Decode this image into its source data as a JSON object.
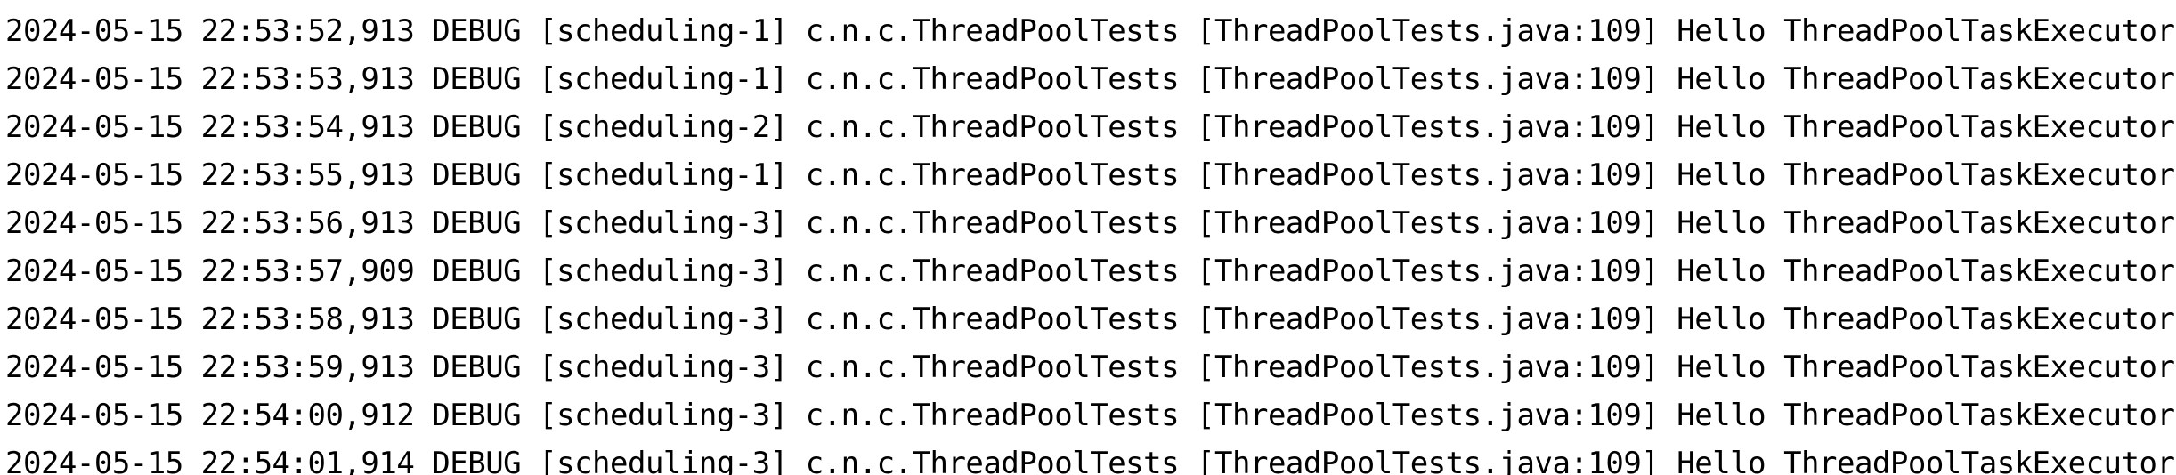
{
  "console": {
    "colors": {
      "background": "#ffffff",
      "text": "#000000"
    },
    "lines": [
      {
        "timestamp": "2024-05-15 22:53:52,913",
        "level": "DEBUG",
        "thread": "[scheduling-1]",
        "logger": "c.n.c.ThreadPoolTests",
        "location": "[ThreadPoolTests.java:109]",
        "message": "Hello ThreadPoolTaskExecutor"
      },
      {
        "timestamp": "2024-05-15 22:53:53,913",
        "level": "DEBUG",
        "thread": "[scheduling-1]",
        "logger": "c.n.c.ThreadPoolTests",
        "location": "[ThreadPoolTests.java:109]",
        "message": "Hello ThreadPoolTaskExecutor"
      },
      {
        "timestamp": "2024-05-15 22:53:54,913",
        "level": "DEBUG",
        "thread": "[scheduling-2]",
        "logger": "c.n.c.ThreadPoolTests",
        "location": "[ThreadPoolTests.java:109]",
        "message": "Hello ThreadPoolTaskExecutor"
      },
      {
        "timestamp": "2024-05-15 22:53:55,913",
        "level": "DEBUG",
        "thread": "[scheduling-1]",
        "logger": "c.n.c.ThreadPoolTests",
        "location": "[ThreadPoolTests.java:109]",
        "message": "Hello ThreadPoolTaskExecutor"
      },
      {
        "timestamp": "2024-05-15 22:53:56,913",
        "level": "DEBUG",
        "thread": "[scheduling-3]",
        "logger": "c.n.c.ThreadPoolTests",
        "location": "[ThreadPoolTests.java:109]",
        "message": "Hello ThreadPoolTaskExecutor"
      },
      {
        "timestamp": "2024-05-15 22:53:57,909",
        "level": "DEBUG",
        "thread": "[scheduling-3]",
        "logger": "c.n.c.ThreadPoolTests",
        "location": "[ThreadPoolTests.java:109]",
        "message": "Hello ThreadPoolTaskExecutor"
      },
      {
        "timestamp": "2024-05-15 22:53:58,913",
        "level": "DEBUG",
        "thread": "[scheduling-3]",
        "logger": "c.n.c.ThreadPoolTests",
        "location": "[ThreadPoolTests.java:109]",
        "message": "Hello ThreadPoolTaskExecutor"
      },
      {
        "timestamp": "2024-05-15 22:53:59,913",
        "level": "DEBUG",
        "thread": "[scheduling-3]",
        "logger": "c.n.c.ThreadPoolTests",
        "location": "[ThreadPoolTests.java:109]",
        "message": "Hello ThreadPoolTaskExecutor"
      },
      {
        "timestamp": "2024-05-15 22:54:00,912",
        "level": "DEBUG",
        "thread": "[scheduling-3]",
        "logger": "c.n.c.ThreadPoolTests",
        "location": "[ThreadPoolTests.java:109]",
        "message": "Hello ThreadPoolTaskExecutor"
      },
      {
        "timestamp": "2024-05-15 22:54:01,914",
        "level": "DEBUG",
        "thread": "[scheduling-3]",
        "logger": "c.n.c.ThreadPoolTests",
        "location": "[ThreadPoolTests.java:109]",
        "message": "Hello ThreadPoolTaskExecutor"
      }
    ]
  }
}
